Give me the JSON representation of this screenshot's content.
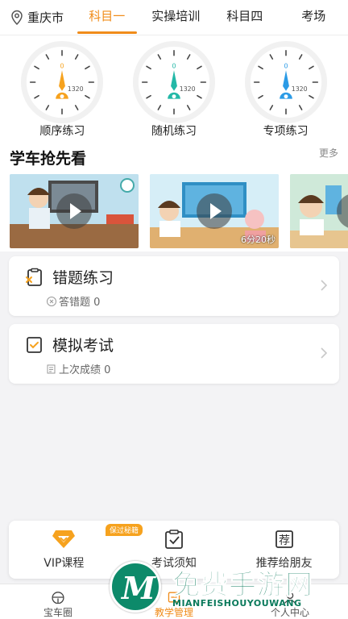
{
  "header": {
    "city": "重庆市",
    "tabs": [
      {
        "label": "科目一",
        "active": true
      },
      {
        "label": "实操培训",
        "active": false
      },
      {
        "label": "科目四",
        "active": false
      },
      {
        "label": "考场",
        "active": false
      }
    ],
    "accent_color": "#f08c1a"
  },
  "practice": [
    {
      "label": "顺序练习",
      "dial_zero": "0",
      "dial_count": "1320",
      "needle_color": "#f6a21e",
      "icon": "dial-gauge-icon"
    },
    {
      "label": "随机练习",
      "dial_zero": "0",
      "dial_count": "1320",
      "needle_color": "#23b8a7",
      "icon": "dial-gauge-icon"
    },
    {
      "label": "专项练习",
      "dial_zero": "0",
      "dial_count": "1320",
      "needle_color": "#2b9be6",
      "icon": "dial-gauge-icon"
    }
  ],
  "videos": {
    "title": "学车抢先看",
    "more_label": "更多",
    "items": [
      {
        "duration": ""
      },
      {
        "duration": "6分20秒"
      },
      {
        "duration": ""
      }
    ]
  },
  "cards": [
    {
      "title": "错题练习",
      "sub_label": "答错题 0",
      "icon": "wrong-question-icon",
      "sub_icon": "x-circle-icon"
    },
    {
      "title": "模拟考试",
      "sub_label": "上次成绩 0",
      "icon": "exam-checkbox-icon",
      "sub_icon": "score-sheet-icon"
    }
  ],
  "panel": {
    "vip_badge": "保过秘籍",
    "items": [
      {
        "label": "VIP课程",
        "icon": "vip-diamond-icon"
      },
      {
        "label": "考试须知",
        "icon": "clipboard-check-icon"
      },
      {
        "label": "推荐给朋友",
        "icon": "recommend-icon",
        "glyph": "荐"
      }
    ]
  },
  "tabbar": {
    "items": [
      {
        "label": "宝车圈",
        "icon": "steering-wheel-icon",
        "active": false
      },
      {
        "label": "教学管理",
        "icon": "teaching-icon",
        "active": true
      },
      {
        "label": "个人中心",
        "icon": "user-icon",
        "active": false
      }
    ]
  },
  "watermark": {
    "text": "免费手游网",
    "sub": "MIANFEISHOUYOUWANG",
    "logo_letter": "M"
  }
}
